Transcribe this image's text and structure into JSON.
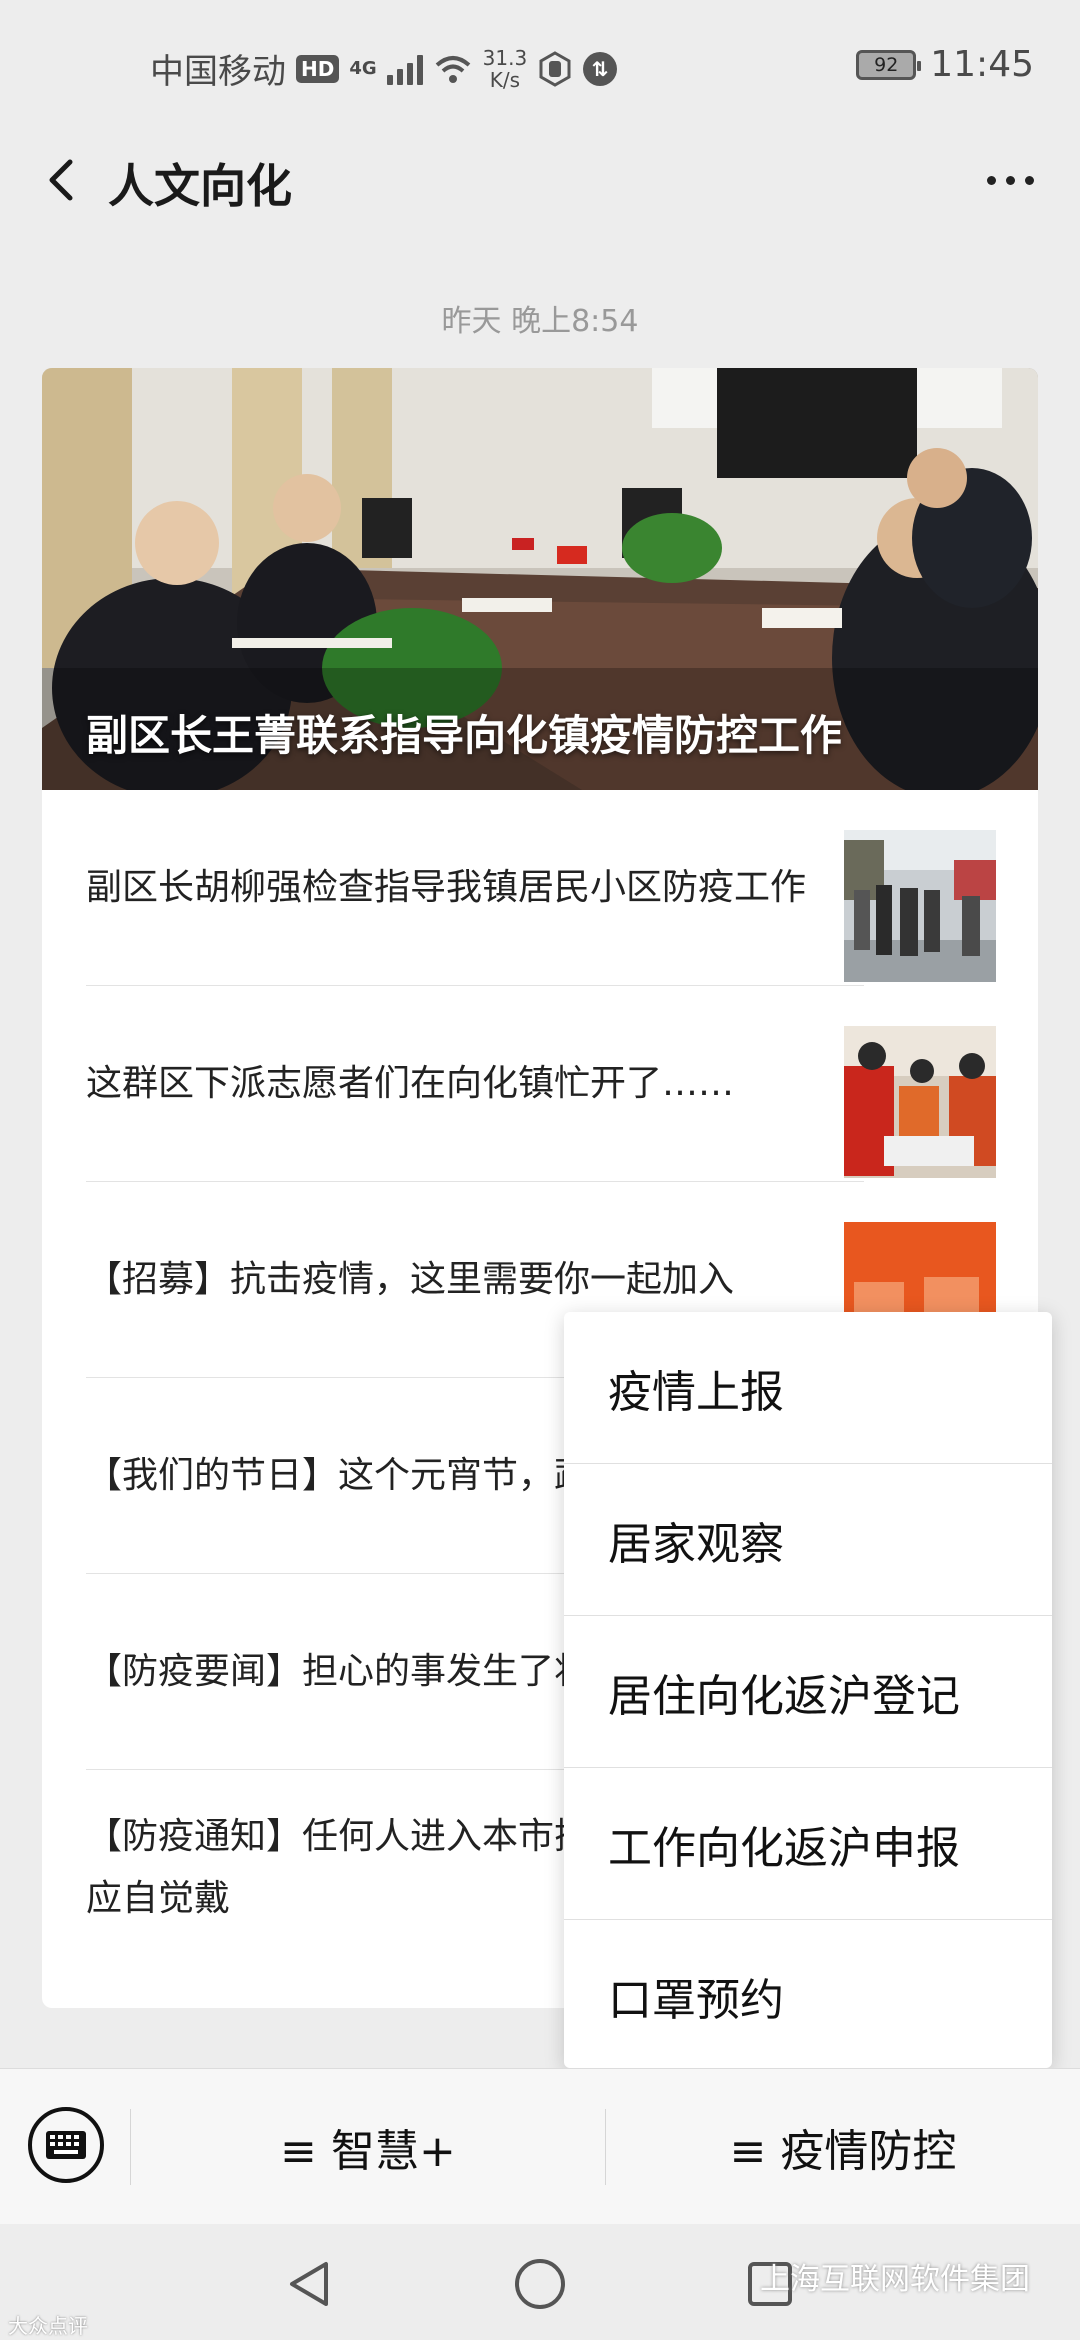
{
  "status_bar": {
    "carrier": "中国移动",
    "hd": "HD",
    "network": "4G",
    "speed_value": "31.3",
    "speed_unit": "K/s",
    "battery": "92",
    "time": "11:45"
  },
  "header": {
    "title": "人文向化"
  },
  "timestamp": "昨天 晚上8:54",
  "card": {
    "cover_title": "副区长王菁联系指导向化镇疫情防控工作",
    "items": [
      {
        "label": "副区长胡柳强检查指导我镇居民小区防疫工作"
      },
      {
        "label": "这群区下派志愿者们在向化镇忙开了……"
      },
      {
        "label": "【招募】抗击疫情，这里需要你一起加入"
      },
      {
        "label": "【我们的节日】这个元宵节，蔬菜，贴心到家"
      },
      {
        "label": "【防疫要闻】担心的事发生了将致多人感染！"
      },
      {
        "label": "【防疫通知】任何人进入本市搭乘公共交通工具应自觉戴"
      }
    ]
  },
  "popup_menu": {
    "items": [
      {
        "label": "疫情上报"
      },
      {
        "label": "居家观察"
      },
      {
        "label": "居住向化返沪登记"
      },
      {
        "label": "工作向化返沪申报"
      },
      {
        "label": "口罩预约"
      }
    ]
  },
  "menu_bar": {
    "tab1": "≡ 智慧+",
    "tab2": "≡ 疫情防控"
  },
  "watermark": {
    "left": "大众点评",
    "right": "上海互联网软件集团"
  }
}
